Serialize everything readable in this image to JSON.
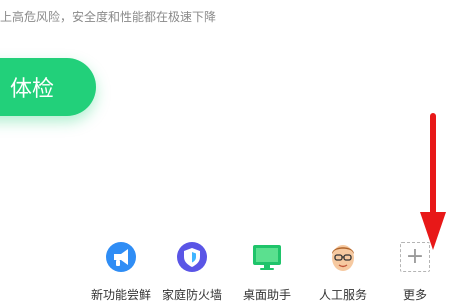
{
  "notice": {
    "text": "上高危风险，安全度和性能都在极速下降"
  },
  "scan_button": {
    "label": "体检"
  },
  "tools": [
    {
      "label": "新功能尝鲜",
      "icon": "megaphone-icon"
    },
    {
      "label": "家庭防火墙",
      "icon": "shield-icon"
    },
    {
      "label": "桌面助手",
      "icon": "monitor-icon"
    },
    {
      "label": "人工服务",
      "icon": "support-avatar-icon"
    },
    {
      "label": "更多",
      "icon": "plus-icon"
    }
  ],
  "colors": {
    "accent_green": "#22d07a",
    "arrow_red": "#e81818"
  }
}
